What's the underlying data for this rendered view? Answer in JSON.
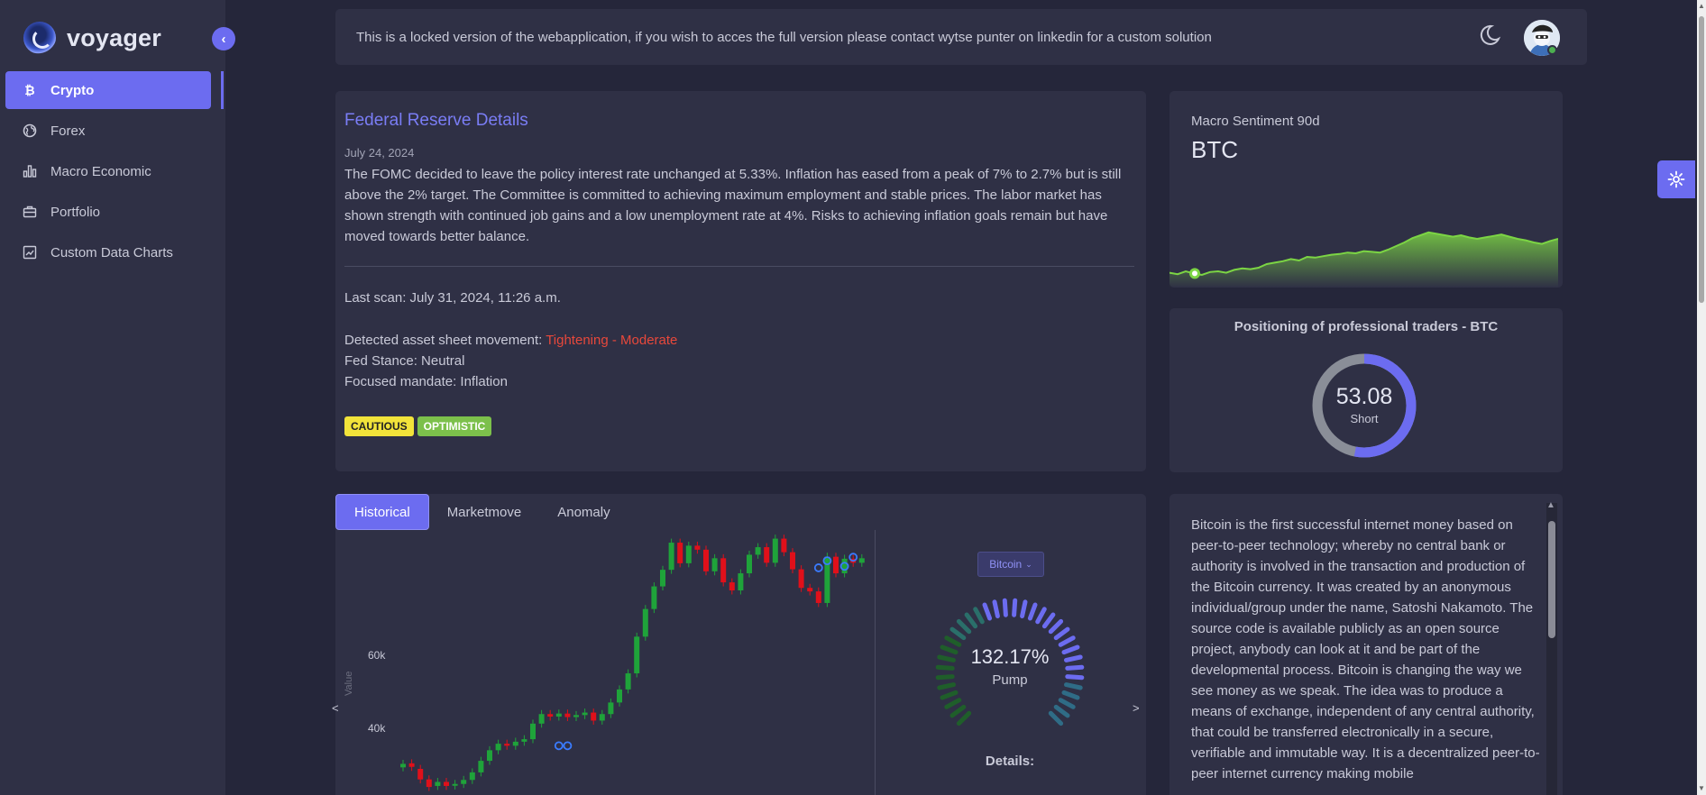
{
  "app": {
    "name": "voyager"
  },
  "sidebar": {
    "items": [
      {
        "label": "Crypto",
        "icon": "bitcoin-icon",
        "active": true
      },
      {
        "label": "Forex",
        "icon": "globe-icon"
      },
      {
        "label": "Macro Economic",
        "icon": "bar-chart-icon"
      },
      {
        "label": "Portfolio",
        "icon": "briefcase-icon"
      },
      {
        "label": "Custom Data Charts",
        "icon": "line-chart-icon"
      }
    ]
  },
  "banner": {
    "text": "This is a locked version of the webapplication, if you wish to acces the full version please contact wytse punter on linkedin for a custom solution"
  },
  "fed": {
    "title": "Federal Reserve Details",
    "date": "July 24, 2024",
    "text": "The FOMC decided to leave the policy interest rate unchanged at 5.33%. Inflation has eased from a peak of 7% to 2.7% but is still above the 2% target. The Committee is committed to achieving maximum employment and stable prices. The labor market has shown strength with continued job gains and a low unemployment rate at 4%. Risks to achieving inflation goals remain but have moved towards better balance.",
    "last_scan": "Last scan: July 31, 2024, 11:26 a.m.",
    "movement_label": "Detected asset sheet movement: ",
    "movement_value": "Tightening - Moderate",
    "stance": "Fed Stance: Neutral",
    "mandate": "Focused mandate: Inflation",
    "badges": [
      "CAUTIOUS",
      "OPTIMISTIC"
    ]
  },
  "sentiment": {
    "label": "Macro Sentiment 90d",
    "asset": "BTC",
    "series": [
      0.08,
      0.06,
      0.1,
      0.07,
      0.05,
      0.09,
      0.1,
      0.08,
      0.12,
      0.14,
      0.13,
      0.15,
      0.2,
      0.22,
      0.24,
      0.27,
      0.25,
      0.3,
      0.29,
      0.31,
      0.33,
      0.34,
      0.36,
      0.35,
      0.38,
      0.37,
      0.36,
      0.4,
      0.45,
      0.5,
      0.56,
      0.6,
      0.64,
      0.62,
      0.6,
      0.58,
      0.6,
      0.57,
      0.55,
      0.57,
      0.59,
      0.61,
      0.58,
      0.55,
      0.53,
      0.5,
      0.48,
      0.52,
      0.55
    ]
  },
  "positioning": {
    "title": "Positioning of professional traders - BTC",
    "value": "53.08",
    "sub": "Short",
    "percent": 53.08
  },
  "tabs": [
    "Historical",
    "Marketmove",
    "Anomaly"
  ],
  "candle_chart": {
    "y_ticks": [
      "60k",
      "40k"
    ],
    "y_label": "Value",
    "candles": [
      [
        25.5,
        26.2
      ],
      [
        26.3,
        25.6
      ],
      [
        25.2,
        23.1
      ],
      [
        23.1,
        21.6
      ],
      [
        21.8,
        22.6
      ],
      [
        22.6,
        21.8
      ],
      [
        21.9,
        22.2
      ],
      [
        22.2,
        23.0
      ],
      [
        23.0,
        24.5
      ],
      [
        24.5,
        26.8
      ],
      [
        26.8,
        28.9
      ],
      [
        28.9,
        30.2
      ],
      [
        30.2,
        29.8
      ],
      [
        29.8,
        30.6
      ],
      [
        30.6,
        31.1
      ],
      [
        31.1,
        34.2
      ],
      [
        34.2,
        36.1
      ],
      [
        36.1,
        35.6
      ],
      [
        35.6,
        36.2
      ],
      [
        36.2,
        35.5
      ],
      [
        35.5,
        35.9
      ],
      [
        35.9,
        36.4
      ],
      [
        36.4,
        34.8
      ],
      [
        34.8,
        36.1
      ],
      [
        36.1,
        38.4
      ],
      [
        38.4,
        41.0
      ],
      [
        41.0,
        44.2
      ],
      [
        44.2,
        51.5
      ],
      [
        51.5,
        57.0
      ],
      [
        57.0,
        61.5
      ],
      [
        61.5,
        64.8
      ],
      [
        64.8,
        70.2
      ],
      [
        70.2,
        66.1
      ],
      [
        66.1,
        69.6
      ],
      [
        69.6,
        68.8
      ],
      [
        68.8,
        64.5
      ],
      [
        64.5,
        67.1
      ],
      [
        67.1,
        62.3
      ],
      [
        62.3,
        60.7
      ],
      [
        60.7,
        64.1
      ],
      [
        64.1,
        67.8
      ],
      [
        67.8,
        69.3
      ],
      [
        69.3,
        66.2
      ],
      [
        66.2,
        71.0
      ],
      [
        71.0,
        68.3
      ],
      [
        68.3,
        64.9
      ],
      [
        64.9,
        61.2
      ],
      [
        61.2,
        60.5
      ],
      [
        60.5,
        58.2
      ],
      [
        58.2,
        67.4
      ],
      [
        67.4,
        64.1
      ],
      [
        64.1,
        67.0
      ],
      [
        67.0,
        66.2
      ],
      [
        66.2,
        67.1
      ]
    ],
    "markers": [
      [
        18,
        29.8
      ],
      [
        19,
        29.8
      ],
      [
        48,
        65.2
      ],
      [
        49,
        66.6
      ],
      [
        51,
        65.5
      ],
      [
        52,
        67.3
      ]
    ]
  },
  "coin_select": {
    "value": "Bitcoin"
  },
  "market_gauge": {
    "value": "132.17%",
    "sub": "Pump",
    "details_label": "Details:"
  },
  "description": {
    "text": "Bitcoin is the first successful internet money based on peer-to-peer technology; whereby no central bank or authority is involved in the transaction and production of the Bitcoin currency. It was created by an anonymous individual/group under the name, Satoshi Nakamoto. The source code is available publicly as an open source project, anybody can look at it and be part of the developmental process. Bitcoin is changing the way we see money as we speak. The idea was to produce a means of exchange, independent of any central authority, that could be transferred electronically in a secure, verifiable and immutable way. It is a decentralized peer-to-peer internet currency making mobile"
  },
  "colors": {
    "accent": "#6c6cf0",
    "bull": "#1fa33a",
    "bear": "#e0101a",
    "sentiment": "#7cd544",
    "warn": "#e8483b"
  }
}
